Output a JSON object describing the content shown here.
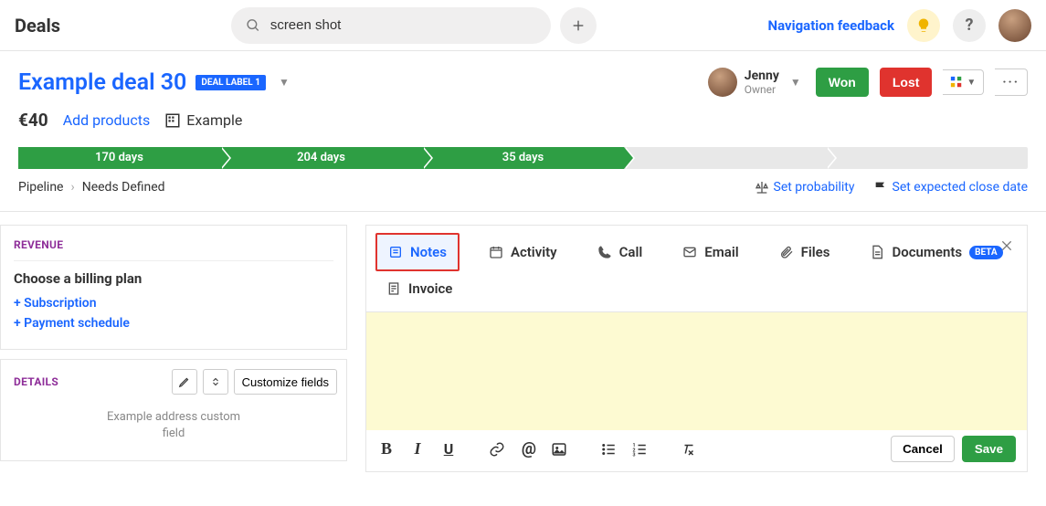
{
  "topbar": {
    "title": "Deals",
    "search_value": "screen shot",
    "nav_feedback": "Navigation feedback"
  },
  "deal": {
    "title": "Example deal 30",
    "label": "DEAL LABEL 1",
    "amount": "€40",
    "add_products": "Add products",
    "org_name": "Example",
    "owner_name": "Jenny",
    "owner_role": "Owner",
    "won_label": "Won",
    "lost_label": "Lost"
  },
  "stages": [
    "170 days",
    "204 days",
    "35 days",
    "",
    ""
  ],
  "breadcrumb": {
    "root": "Pipeline",
    "current": "Needs Defined",
    "set_probability": "Set probability",
    "set_close_date": "Set expected close date"
  },
  "revenue": {
    "title": "REVENUE",
    "choose_plan": "Choose a billing plan",
    "subscription": "+ Subscription",
    "payment_schedule": "+ Payment schedule"
  },
  "details": {
    "title": "DETAILS",
    "customize": "Customize fields",
    "field_label": "Example address custom field"
  },
  "tabs": {
    "notes": "Notes",
    "activity": "Activity",
    "call": "Call",
    "email": "Email",
    "files": "Files",
    "documents": "Documents",
    "documents_badge": "BETA",
    "invoice": "Invoice",
    "cancel": "Cancel",
    "save": "Save"
  }
}
